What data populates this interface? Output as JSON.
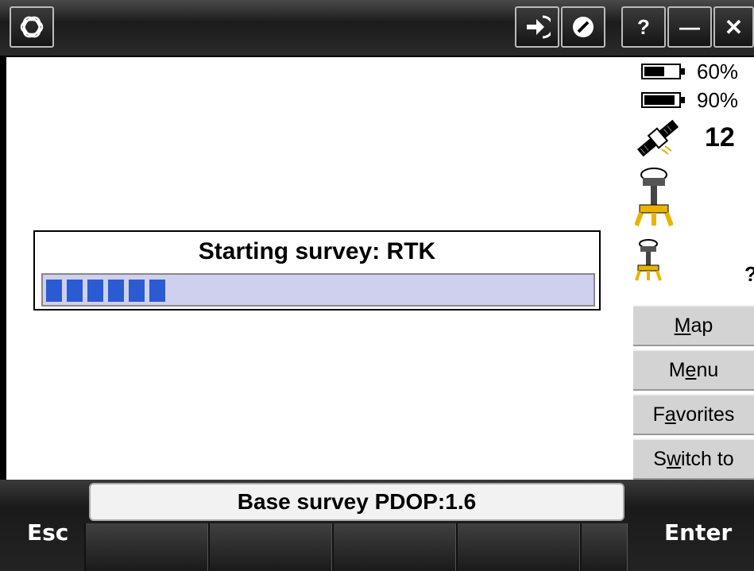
{
  "topbar": {
    "logo_icon": "trimble-globe-icon",
    "connect_icon": "connect-arrow-icon",
    "disconnect_icon": "no-entry-icon",
    "help_label": "?",
    "minimize_label": "—",
    "close_label": "✕"
  },
  "status_panel": {
    "battery1": {
      "percent": "60%",
      "level": 0.6
    },
    "battery2": {
      "percent": "90%",
      "level": 0.9
    },
    "satellites": "12",
    "rover_icon": "rover-receiver-icon",
    "base_icon": "base-receiver-icon",
    "base_status": "?"
  },
  "side_buttons": [
    {
      "pre": "",
      "key": "M",
      "post": "ap"
    },
    {
      "pre": "M",
      "key": "e",
      "post": "nu"
    },
    {
      "pre": "F",
      "key": "a",
      "post": "vorites"
    },
    {
      "pre": "S",
      "key": "w",
      "post": "itch to"
    }
  ],
  "dialog": {
    "title": "Starting survey: RTK",
    "progress_segments": 6,
    "progress_total_segments": 27
  },
  "status_bar": {
    "text": "Base survey  PDOP:1.6"
  },
  "keys": {
    "esc": "Esc",
    "enter": "Enter"
  }
}
